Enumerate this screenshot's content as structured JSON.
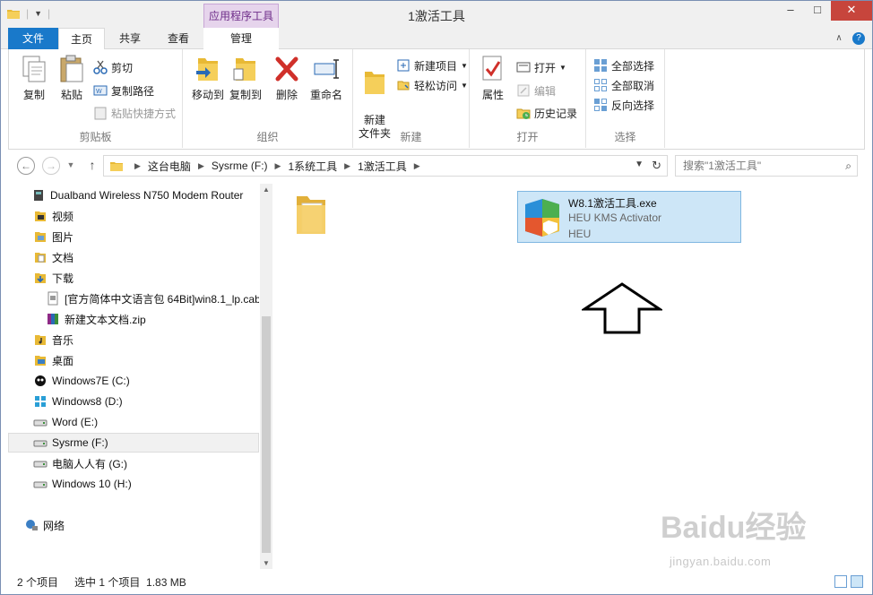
{
  "window": {
    "title": "1激活工具",
    "context_tab": "应用程序工具",
    "buttons": {
      "minimize": "–",
      "maximize": "□",
      "close": "✕"
    }
  },
  "ribbon_tabs": {
    "file": "文件",
    "home": "主页",
    "share": "共享",
    "view": "查看",
    "manage": "管理"
  },
  "ribbon": {
    "clipboard": {
      "label": "剪贴板",
      "copy": "复制",
      "paste": "粘贴",
      "cut": "剪切",
      "copy_path": "复制路径",
      "paste_shortcut": "粘贴快捷方式"
    },
    "organize": {
      "label": "组织",
      "move_to": "移动到",
      "copy_to": "复制到",
      "delete": "删除",
      "rename": "重命名"
    },
    "new": {
      "label": "新建",
      "new_folder": "新建\n文件夹",
      "new_item": "新建项目",
      "easy_access": "轻松访问"
    },
    "open": {
      "label": "打开",
      "properties": "属性",
      "open": "打开",
      "edit": "编辑",
      "history": "历史记录"
    },
    "select": {
      "label": "选择",
      "select_all": "全部选择",
      "select_none": "全部取消",
      "invert": "反向选择"
    }
  },
  "address": {
    "crumbs": [
      "这台电脑",
      "Sysrme (F:)",
      "1系统工具",
      "1激活工具"
    ],
    "search_placeholder": "搜索\"1激活工具\""
  },
  "nav_pane": {
    "items": [
      {
        "label": "Dualband Wireless N750 Modem Router",
        "icon": "network-device-icon"
      },
      {
        "label": "视频",
        "icon": "videos-folder-icon"
      },
      {
        "label": "图片",
        "icon": "pictures-folder-icon"
      },
      {
        "label": "文档",
        "icon": "documents-folder-icon"
      },
      {
        "label": "下载",
        "icon": "downloads-folder-icon"
      },
      {
        "label": "[官方简体中文语言包 64Bit]win8.1_lp.cab",
        "icon": "cab-file-icon"
      },
      {
        "label": "新建文本文档.zip",
        "icon": "zip-file-icon"
      },
      {
        "label": "音乐",
        "icon": "music-folder-icon"
      },
      {
        "label": "桌面",
        "icon": "desktop-folder-icon"
      },
      {
        "label": "Windows7E (C:)",
        "icon": "drive-c-icon"
      },
      {
        "label": "Windows8 (D:)",
        "icon": "drive-d-icon"
      },
      {
        "label": "Word (E:)",
        "icon": "drive-icon"
      },
      {
        "label": "Sysrme (F:)",
        "icon": "drive-icon"
      },
      {
        "label": "电脑人人有 (G:)",
        "icon": "drive-icon"
      },
      {
        "label": "Windows 10 (H:)",
        "icon": "drive-icon"
      },
      {
        "label": "网络",
        "icon": "network-icon"
      }
    ]
  },
  "files": {
    "selected_file": {
      "name": "W8.1激活工具.exe",
      "description": "HEU KMS Activator",
      "company": "HEU"
    }
  },
  "status": {
    "item_count": "2 个项目",
    "selection": "选中 1 个项目  1.83 MB"
  },
  "watermark": {
    "text": "Baidu经验",
    "url": "jingyan.baidu.com"
  },
  "colors": {
    "file_tab": "#1979ca",
    "selection": "#cde6f7",
    "context_tab": "#e6d4ec"
  }
}
